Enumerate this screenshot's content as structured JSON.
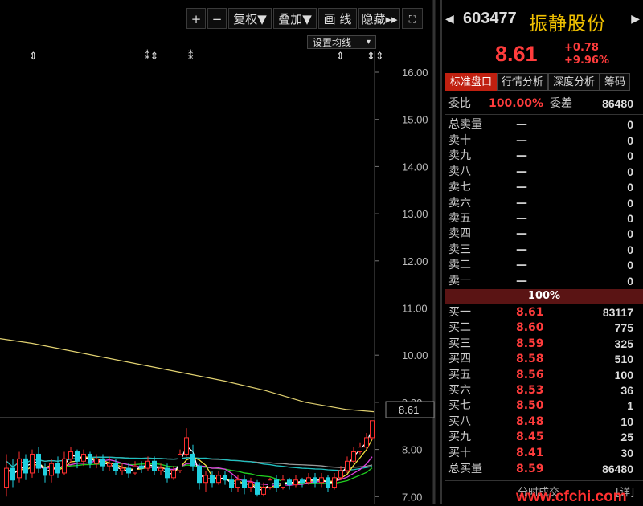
{
  "toolbar": {
    "plus": "+",
    "minus": "−",
    "fuquan": "复权▼",
    "diejia": "叠加▼",
    "huaxian": "画 线",
    "yincang": "隐藏▸▸",
    "expand_icon": "expand-icon"
  },
  "ma_setting": {
    "label": "设置均线",
    "arrow": "▾"
  },
  "chart_data": {
    "type": "candlestick",
    "y_ticks": [
      "16.00",
      "15.00",
      "14.00",
      "13.00",
      "12.00",
      "11.00",
      "10.00",
      "9.00",
      "8.00",
      "7.00"
    ],
    "ylim": [
      7.0,
      16.4
    ],
    "current_price_label": "8.61",
    "markers": [
      "⇕",
      "⁑⇕",
      "⁑",
      "⇕",
      "⇕⇕"
    ],
    "long_ma": [
      [
        0,
        10.35
      ],
      [
        40,
        10.25
      ],
      [
        100,
        10.05
      ],
      [
        160,
        9.85
      ],
      [
        220,
        9.65
      ],
      [
        280,
        9.45
      ],
      [
        330,
        9.25
      ],
      [
        380,
        9.0
      ],
      [
        430,
        8.85
      ],
      [
        465,
        8.8
      ]
    ],
    "candles": [
      [
        8,
        7.2,
        7.6,
        7.0,
        7.9
      ],
      [
        16,
        7.6,
        7.35,
        7.2,
        7.8
      ],
      [
        24,
        7.4,
        7.8,
        7.3,
        7.95
      ],
      [
        32,
        7.8,
        7.5,
        7.35,
        7.9
      ],
      [
        40,
        7.5,
        7.9,
        7.4,
        8.0
      ],
      [
        48,
        7.9,
        7.6,
        7.5,
        8.05
      ],
      [
        56,
        7.6,
        7.45,
        7.3,
        7.7
      ],
      [
        64,
        7.45,
        7.7,
        7.3,
        7.8
      ],
      [
        72,
        7.7,
        7.5,
        7.4,
        7.85
      ],
      [
        80,
        7.5,
        7.8,
        7.45,
        7.95
      ],
      [
        88,
        7.8,
        7.95,
        7.7,
        8.05
      ],
      [
        96,
        7.95,
        7.75,
        7.6,
        8.0
      ],
      [
        104,
        7.75,
        7.9,
        7.65,
        8.0
      ],
      [
        112,
        7.9,
        7.7,
        7.6,
        7.95
      ],
      [
        120,
        7.7,
        7.8,
        7.6,
        7.9
      ],
      [
        128,
        7.8,
        7.65,
        7.55,
        7.9
      ],
      [
        136,
        7.65,
        7.7,
        7.55,
        7.85
      ],
      [
        144,
        7.7,
        7.55,
        7.45,
        7.8
      ],
      [
        152,
        7.55,
        7.6,
        7.45,
        7.7
      ],
      [
        160,
        7.6,
        7.5,
        7.4,
        7.7
      ],
      [
        168,
        7.5,
        7.65,
        7.45,
        7.75
      ],
      [
        176,
        7.65,
        7.6,
        7.5,
        7.75
      ],
      [
        184,
        7.6,
        7.75,
        7.55,
        7.85
      ],
      [
        192,
        7.75,
        7.55,
        7.45,
        7.85
      ],
      [
        200,
        7.55,
        7.6,
        7.45,
        7.7
      ],
      [
        208,
        7.6,
        7.4,
        7.3,
        7.7
      ],
      [
        216,
        7.4,
        7.55,
        7.35,
        7.65
      ],
      [
        224,
        7.55,
        7.9,
        7.5,
        8.0
      ],
      [
        232,
        7.9,
        8.25,
        7.85,
        8.45
      ],
      [
        240,
        7.9,
        7.65,
        7.55,
        8.1
      ],
      [
        248,
        7.65,
        7.3,
        7.15,
        7.7
      ],
      [
        256,
        7.3,
        7.45,
        7.1,
        7.55
      ],
      [
        264,
        7.45,
        7.3,
        7.2,
        7.55
      ],
      [
        272,
        7.3,
        7.45,
        7.25,
        7.55
      ],
      [
        280,
        7.45,
        7.35,
        7.25,
        7.55
      ],
      [
        288,
        7.35,
        7.2,
        7.1,
        7.45
      ],
      [
        296,
        7.2,
        7.35,
        7.1,
        7.45
      ],
      [
        304,
        7.35,
        7.2,
        7.05,
        7.45
      ],
      [
        312,
        7.2,
        7.3,
        7.1,
        7.4
      ],
      [
        320,
        7.3,
        7.05,
        7.0,
        7.35
      ],
      [
        328,
        7.05,
        7.2,
        7.0,
        7.3
      ],
      [
        336,
        7.2,
        7.35,
        7.15,
        7.4
      ],
      [
        344,
        7.35,
        7.2,
        7.1,
        7.45
      ],
      [
        352,
        7.2,
        7.35,
        7.15,
        7.45
      ],
      [
        360,
        7.35,
        7.25,
        7.15,
        7.4
      ],
      [
        368,
        7.25,
        7.35,
        7.2,
        7.45
      ],
      [
        376,
        7.35,
        7.3,
        7.2,
        7.4
      ],
      [
        384,
        7.3,
        7.4,
        7.25,
        7.5
      ],
      [
        392,
        7.4,
        7.3,
        7.2,
        7.5
      ],
      [
        400,
        7.3,
        7.4,
        7.2,
        7.5
      ],
      [
        408,
        7.4,
        7.2,
        7.1,
        7.45
      ],
      [
        416,
        7.2,
        7.4,
        7.15,
        7.5
      ],
      [
        424,
        7.4,
        7.55,
        7.35,
        7.65
      ],
      [
        432,
        7.55,
        7.75,
        7.5,
        7.85
      ],
      [
        440,
        7.75,
        7.95,
        7.7,
        8.05
      ],
      [
        448,
        7.95,
        8.05,
        7.9,
        8.15
      ],
      [
        456,
        8.05,
        8.25,
        8.0,
        8.35
      ],
      [
        463,
        8.25,
        8.61,
        8.2,
        8.61
      ]
    ]
  },
  "quote": {
    "code": "603477",
    "name": "振静股份",
    "price": "8.61",
    "change": "+0.78",
    "change_pct": "+9.96%"
  },
  "tabs": [
    "标准盘口",
    "行情分析",
    "深度分析",
    "筹码"
  ],
  "weibi": {
    "label": "委比",
    "value": "100.00%",
    "label2": "委差",
    "value2": "86480"
  },
  "sell_total": {
    "label": "总卖量",
    "price": "—",
    "vol": "0"
  },
  "sells": [
    {
      "label": "卖十",
      "price": "—",
      "vol": "0"
    },
    {
      "label": "卖九",
      "price": "—",
      "vol": "0"
    },
    {
      "label": "卖八",
      "price": "—",
      "vol": "0"
    },
    {
      "label": "卖七",
      "price": "—",
      "vol": "0"
    },
    {
      "label": "卖六",
      "price": "—",
      "vol": "0"
    },
    {
      "label": "卖五",
      "price": "—",
      "vol": "0"
    },
    {
      "label": "卖四",
      "price": "—",
      "vol": "0"
    },
    {
      "label": "卖三",
      "price": "—",
      "vol": "0"
    },
    {
      "label": "卖二",
      "price": "—",
      "vol": "0"
    },
    {
      "label": "卖一",
      "price": "—",
      "vol": "0"
    }
  ],
  "mid_pct": "100%",
  "buys": [
    {
      "label": "买一",
      "price": "8.61",
      "vol": "83117"
    },
    {
      "label": "买二",
      "price": "8.60",
      "vol": "775"
    },
    {
      "label": "买三",
      "price": "8.59",
      "vol": "325"
    },
    {
      "label": "买四",
      "price": "8.58",
      "vol": "510"
    },
    {
      "label": "买五",
      "price": "8.56",
      "vol": "100"
    },
    {
      "label": "买六",
      "price": "8.53",
      "vol": "36"
    },
    {
      "label": "买七",
      "price": "8.50",
      "vol": "1"
    },
    {
      "label": "买八",
      "price": "8.48",
      "vol": "10"
    },
    {
      "label": "买九",
      "price": "8.45",
      "vol": "25"
    },
    {
      "label": "买十",
      "price": "8.41",
      "vol": "30"
    }
  ],
  "buy_total": {
    "label": "总买量",
    "price": "8.59",
    "vol": "86480"
  },
  "footer": {
    "fenshi": "分时成交",
    "detail": "[详]",
    "watermark": "www.cfchi.com"
  }
}
